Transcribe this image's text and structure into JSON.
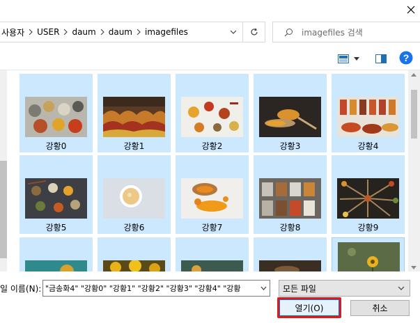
{
  "titlebar": {
    "close_icon": "close-icon"
  },
  "address": {
    "breadcrumbs": [
      "사용자",
      "USER",
      "daum",
      "daum",
      "imagefiles"
    ],
    "dropdown_icon": "chevron-down-icon",
    "refresh_icon": "refresh-icon"
  },
  "search": {
    "placeholder": "imagefiles 검색",
    "icon": "search-icon"
  },
  "toolbar": {
    "view_icon": "view-options-icon",
    "pane_icon": "preview-pane-icon",
    "help_icon": "help-icon",
    "help_glyph": "?"
  },
  "files": [
    {
      "label": "강황0"
    },
    {
      "label": "강황1"
    },
    {
      "label": "강황2"
    },
    {
      "label": "강황3"
    },
    {
      "label": "강황4"
    },
    {
      "label": "강황5"
    },
    {
      "label": "강황6"
    },
    {
      "label": "강황7"
    },
    {
      "label": "강황8"
    },
    {
      "label": "강황9"
    },
    {
      "label": ""
    },
    {
      "label": ""
    },
    {
      "label": ""
    },
    {
      "label": ""
    },
    {
      "label": ""
    }
  ],
  "bottom": {
    "filename_label": "일 이름(N):",
    "filename_value": "\"금송화4\" \"강황0\" \"강황1\" \"강황2\" \"강황3\" \"강황4\" \"강황",
    "filetype_value": "모든 파일",
    "open_label": "열기(O)",
    "cancel_label": "취소"
  },
  "colors": {
    "selection": "#cce8ff",
    "accent": "#0078d7",
    "highlight_box": "#e01a1a",
    "help": "#1a73e8"
  }
}
